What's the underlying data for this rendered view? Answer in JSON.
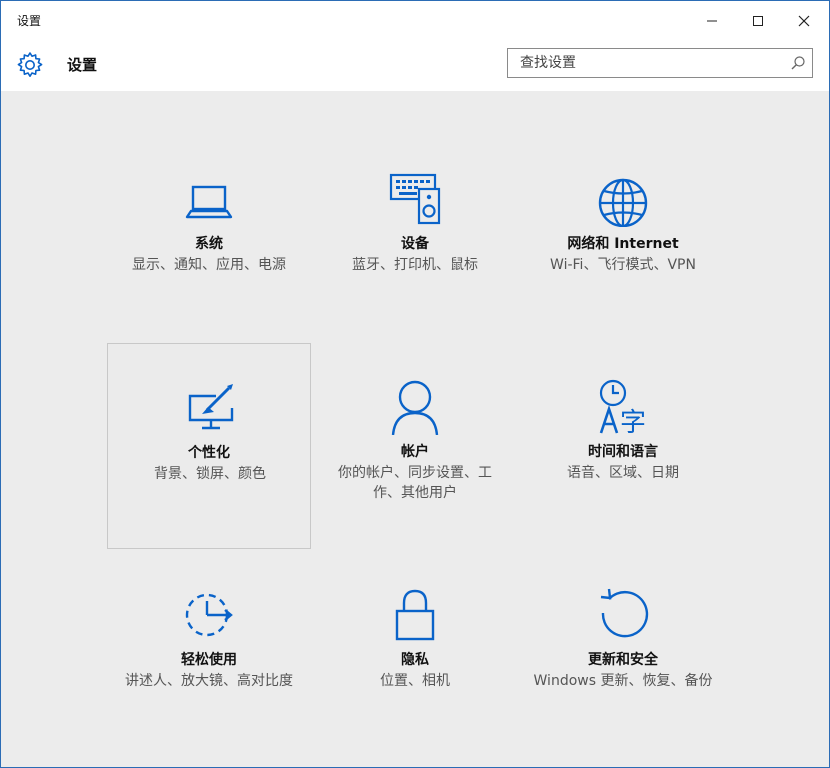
{
  "window": {
    "title": "设置"
  },
  "header": {
    "title": "设置"
  },
  "search": {
    "placeholder": "查找设置"
  },
  "accent": "#0a63c9",
  "tiles": [
    {
      "icon": "laptop-icon",
      "name": "系统",
      "desc": "显示、通知、应用、电源"
    },
    {
      "icon": "devices-icon",
      "name": "设备",
      "desc": "蓝牙、打印机、鼠标"
    },
    {
      "icon": "globe-icon",
      "name": "网络和 Internet",
      "desc": "Wi-Fi、飞行模式、VPN"
    },
    {
      "icon": "personalization-icon",
      "name": "个性化",
      "desc": "背景、锁屏、颜色"
    },
    {
      "icon": "person-icon",
      "name": "帐户",
      "desc": "你的帐户、同步设置、工作、其他用户"
    },
    {
      "icon": "time-language-icon",
      "name": "时间和语言",
      "desc": "语音、区域、日期"
    },
    {
      "icon": "ease-of-access-icon",
      "name": "轻松使用",
      "desc": "讲述人、放大镜、高对比度"
    },
    {
      "icon": "lock-icon",
      "name": "隐私",
      "desc": "位置、相机"
    },
    {
      "icon": "update-icon",
      "name": "更新和安全",
      "desc": "Windows 更新、恢复、备份"
    }
  ]
}
